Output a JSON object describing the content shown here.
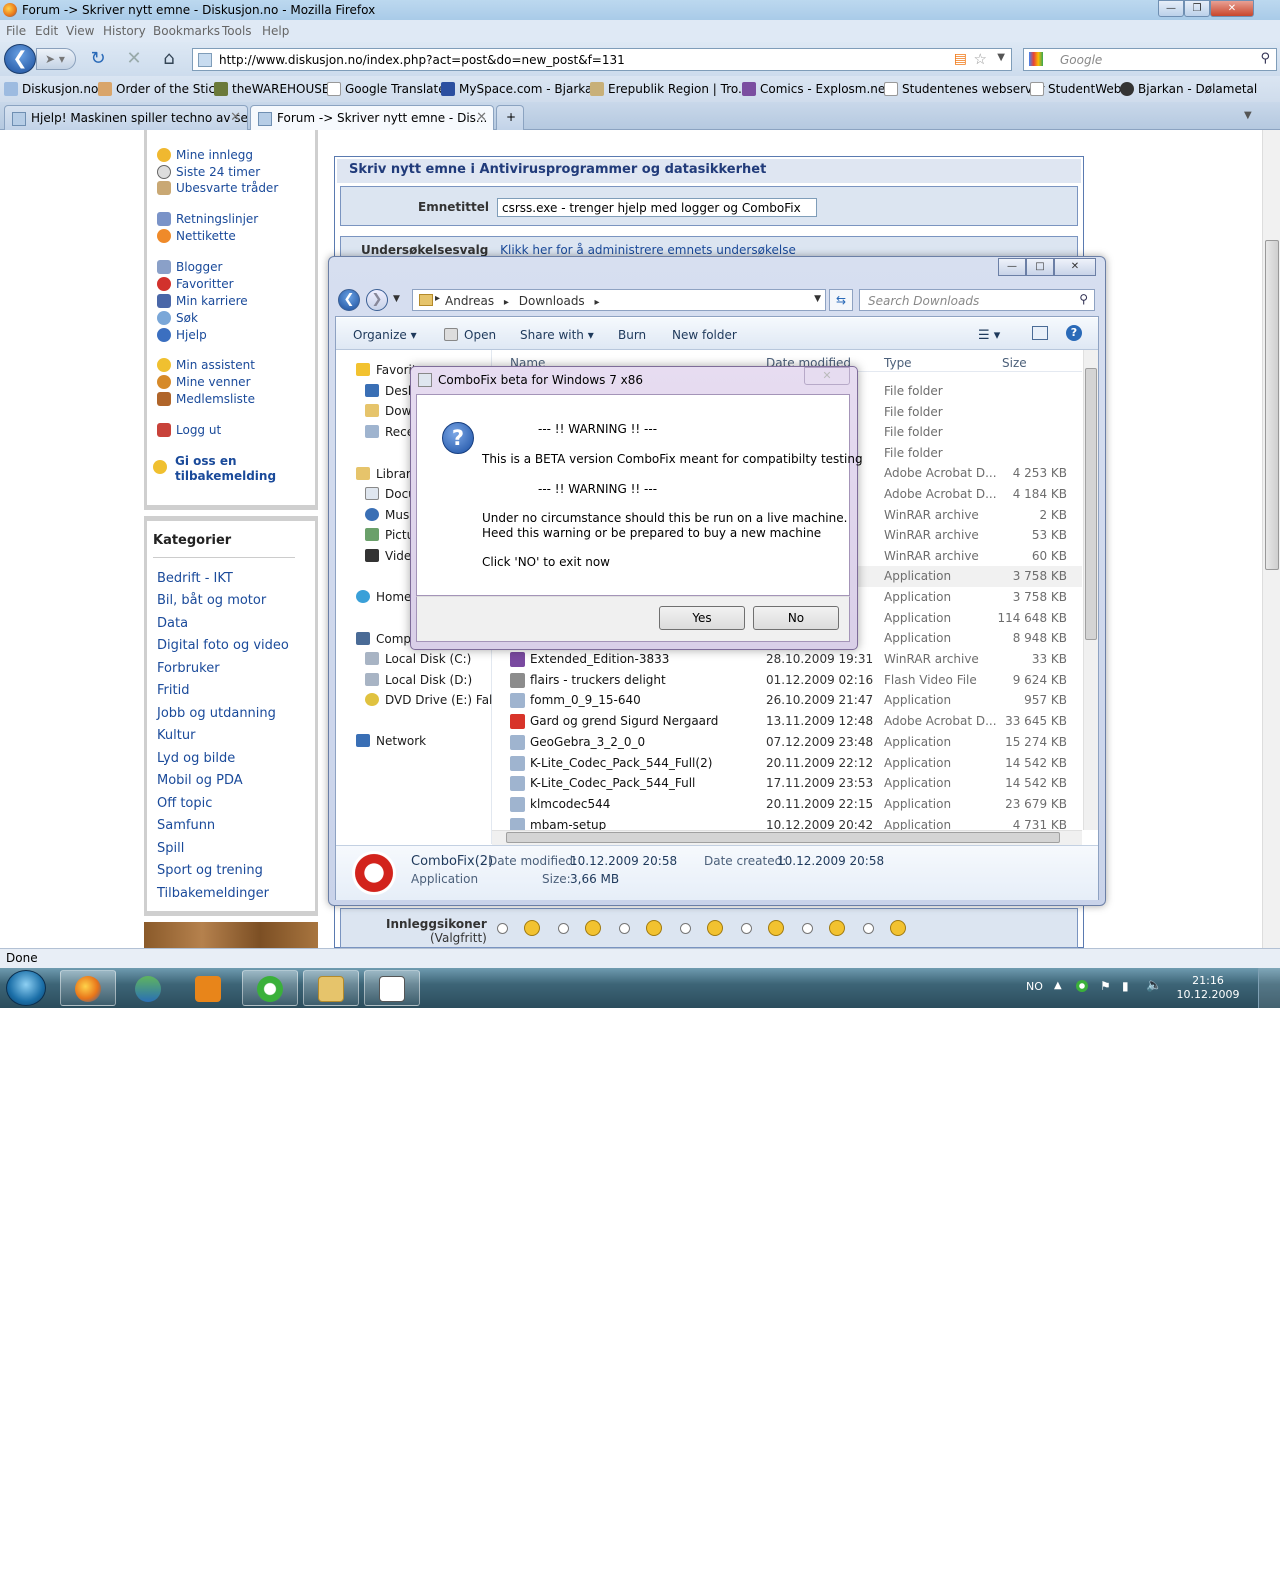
{
  "window": {
    "title": "Forum -> Skriver nytt emne - Diskusjon.no - Mozilla Firefox"
  },
  "menu": [
    "File",
    "Edit",
    "View",
    "History",
    "Bookmarks",
    "Tools",
    "Help"
  ],
  "url": "http://www.diskusjon.no/index.php?act=post&do=new_post&f=131",
  "search_placeholder": "Google",
  "bookmarks": [
    "Diskusjon.no",
    "Order of the Stick",
    "theWAREHOUSE",
    "Google Translate",
    "MySpace.com - Bjarkan",
    "Erepublik Region | Tro...",
    "Comics - Explosm.net",
    "Studentenes webserver",
    "StudentWeb",
    "Bjarkan - Dølametal"
  ],
  "tabs": [
    {
      "label": "Hjelp! Maskinen spiller techno av se..."
    },
    {
      "label": "Forum -> Skriver nytt emne - Dis..."
    }
  ],
  "sidebar": {
    "items": [
      "Mine innlegg",
      "Siste 24 timer",
      "Ubesvarte tråder",
      "Retningslinjer",
      "Nettikette",
      "Blogger",
      "Favoritter",
      "Min karriere",
      "Søk",
      "Hjelp",
      "Min assistent",
      "Mine venner",
      "Medlemsliste",
      "Logg ut"
    ],
    "feedback": [
      "Gi oss en",
      "tilbakemelding"
    ]
  },
  "kategorier": {
    "title": "Kategorier",
    "items": [
      "Bedrift - IKT",
      "Bil, båt og motor",
      "Data",
      "Digital foto og video",
      "Forbruker",
      "Fritid",
      "Jobb og utdanning",
      "Kultur",
      "Lyd og bilde",
      "Mobil og PDA",
      "Off topic",
      "Samfunn",
      "Spill",
      "Sport og trening",
      "Tilbakemeldinger"
    ]
  },
  "form": {
    "heading": "Skriv nytt emne i Antivirusprogrammer og datasikkerhet",
    "emne_label": "Emnetittel",
    "emne_value": "csrss.exe - trenger hjelp med logger og ComboFix",
    "undersokelse_label": "Undersøkelsesvalg",
    "undersokelse_link": "Klikk her for å administrere emnets undersøkelse",
    "innlegg_label": "Innleggsikoner",
    "innlegg_sub": "(Valgfritt)"
  },
  "explorer": {
    "breadcrumb": [
      "Andreas",
      "Downloads"
    ],
    "search_placeholder": "Search Downloads",
    "commands": [
      "Organize",
      "Open",
      "Share with",
      "Burn",
      "New folder"
    ],
    "columns": [
      "Name",
      "Date modified",
      "Type",
      "Size"
    ],
    "nav": [
      "Favorites",
      "Desktop",
      "Downloads",
      "Recent Places",
      "Libraries",
      "Documents",
      "Music",
      "Pictures",
      "Videos",
      "Homegroup",
      "Computer",
      "Local Disk (C:)",
      "Local Disk (D:)",
      "DVD Drive (E:) Fallout",
      "Network"
    ],
    "rows_hidden_types": [
      {
        "type": "File folder",
        "size": ""
      },
      {
        "type": "File folder",
        "size": ""
      },
      {
        "type": "File folder",
        "size": ""
      },
      {
        "type": "File folder",
        "size": ""
      },
      {
        "type": "Adobe Acrobat D...",
        "size": "4 253 KB"
      },
      {
        "type": "Adobe Acrobat D...",
        "size": "4 184 KB"
      },
      {
        "type": "WinRAR archive",
        "size": "2 KB"
      },
      {
        "type": "WinRAR archive",
        "size": "53 KB"
      },
      {
        "type": "WinRAR archive",
        "size": "60 KB"
      },
      {
        "type": "Application",
        "size": "3 758 KB"
      },
      {
        "type": "Application",
        "size": "3 758 KB"
      },
      {
        "type": "Application",
        "size": "114 648 KB"
      },
      {
        "type": "Application",
        "size": "8 948 KB"
      }
    ],
    "rows": [
      {
        "name": "Extended_Edition-3833",
        "date": "28.10.2009 19:31",
        "type": "WinRAR archive",
        "size": "33 KB"
      },
      {
        "name": "flairs - truckers delight",
        "date": "01.12.2009 02:16",
        "type": "Flash Video File",
        "size": "9 624 KB"
      },
      {
        "name": "fomm_0_9_15-640",
        "date": "26.10.2009 21:47",
        "type": "Application",
        "size": "957 KB"
      },
      {
        "name": "Gard og grend Sigurd Nergaard",
        "date": "13.11.2009 12:48",
        "type": "Adobe Acrobat D...",
        "size": "33 645 KB"
      },
      {
        "name": "GeoGebra_3_2_0_0",
        "date": "07.12.2009 23:48",
        "type": "Application",
        "size": "15 274 KB"
      },
      {
        "name": "K-Lite_Codec_Pack_544_Full(2)",
        "date": "20.11.2009 22:12",
        "type": "Application",
        "size": "14 542 KB"
      },
      {
        "name": "K-Lite_Codec_Pack_544_Full",
        "date": "17.11.2009 23:53",
        "type": "Application",
        "size": "14 542 KB"
      },
      {
        "name": "klmcodec544",
        "date": "20.11.2009 22:15",
        "type": "Application",
        "size": "23 679 KB"
      },
      {
        "name": "mbam-setup",
        "date": "10.12.2009 20:42",
        "type": "Application",
        "size": "4 731 KB"
      }
    ],
    "details": {
      "name": "ComboFix(2)",
      "type": "Application",
      "modified_label": "Date modified:",
      "modified": "10.12.2009 20:58",
      "created_label": "Date created:",
      "created": "10.12.2009 20:58",
      "size_label": "Size:",
      "size": "3,66 MB"
    }
  },
  "dialog": {
    "title": "ComboFix beta for Windows 7 x86",
    "warn1": "--- !! WARNING !! ---",
    "line1": "This is a BETA version ComboFix meant for compatibilty testing",
    "warn2": "--- !! WARNING !! ---",
    "line2": "Under no circumstance should this be run on a live machine.",
    "line3": "Heed this warning or be prepared to buy a new machine",
    "line4": "Click 'NO' to exit now",
    "yes": "Yes",
    "no": "No"
  },
  "status": "Done",
  "taskbar": {
    "lang": "NO",
    "time": "21:16",
    "date": "10.12.2009"
  }
}
